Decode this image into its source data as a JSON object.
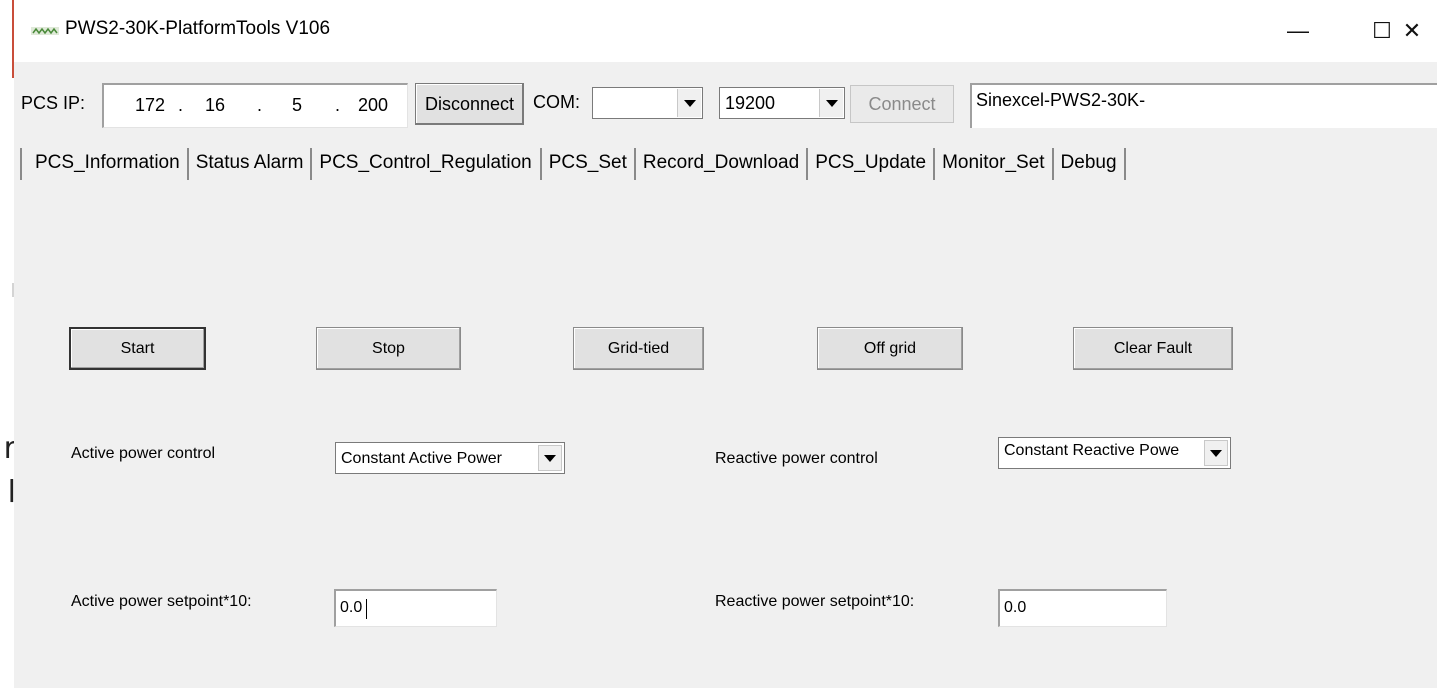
{
  "window": {
    "title": "PWS2-30K-PlatformTools V106",
    "controls": {
      "minimize": "—",
      "maximize": "☐",
      "close": "✕"
    }
  },
  "background_app": {
    "glyph_1": "r",
    "glyph_2": "l"
  },
  "connection": {
    "pcs_ip_label": "PCS IP:",
    "ip_octets": [
      "172",
      "16",
      "5",
      "200"
    ],
    "ip_separator": ".",
    "disconnect_label": "Disconnect",
    "com_label": "COM:",
    "com_value": "",
    "baud_value": "19200",
    "connect_label": "Connect",
    "device_name": "Sinexcel-PWS2-30K-"
  },
  "tabs": [
    {
      "label": "PCS_Information",
      "active": false
    },
    {
      "label": "Status Alarm",
      "active": false
    },
    {
      "label": "PCS_Control_Regulation",
      "active": true
    },
    {
      "label": "PCS_Set",
      "active": false
    },
    {
      "label": "Record_Download",
      "active": false
    },
    {
      "label": "PCS_Update",
      "active": false
    },
    {
      "label": "Monitor_Set",
      "active": false
    },
    {
      "label": "Debug",
      "active": false
    }
  ],
  "actions": {
    "start": "Start",
    "stop": "Stop",
    "grid_tied": "Grid-tied",
    "off_grid": "Off grid",
    "clear_fault": "Clear Fault"
  },
  "controls": {
    "active_power_control_label": "Active power control",
    "active_power_control_value": "Constant Active Power",
    "reactive_power_control_label": "Reactive power control",
    "reactive_power_control_value": "Constant Reactive Powe",
    "active_power_setpoint_label": "Active power setpoint*10:",
    "active_power_setpoint_value": "0.0",
    "reactive_power_setpoint_label": "Reactive power setpoint*10:",
    "reactive_power_setpoint_value": "0.0"
  },
  "colors": {
    "window_bg": "#f0f0f0",
    "titlebar_bg": "#ffffff",
    "accent_line": "#c94e3a"
  }
}
